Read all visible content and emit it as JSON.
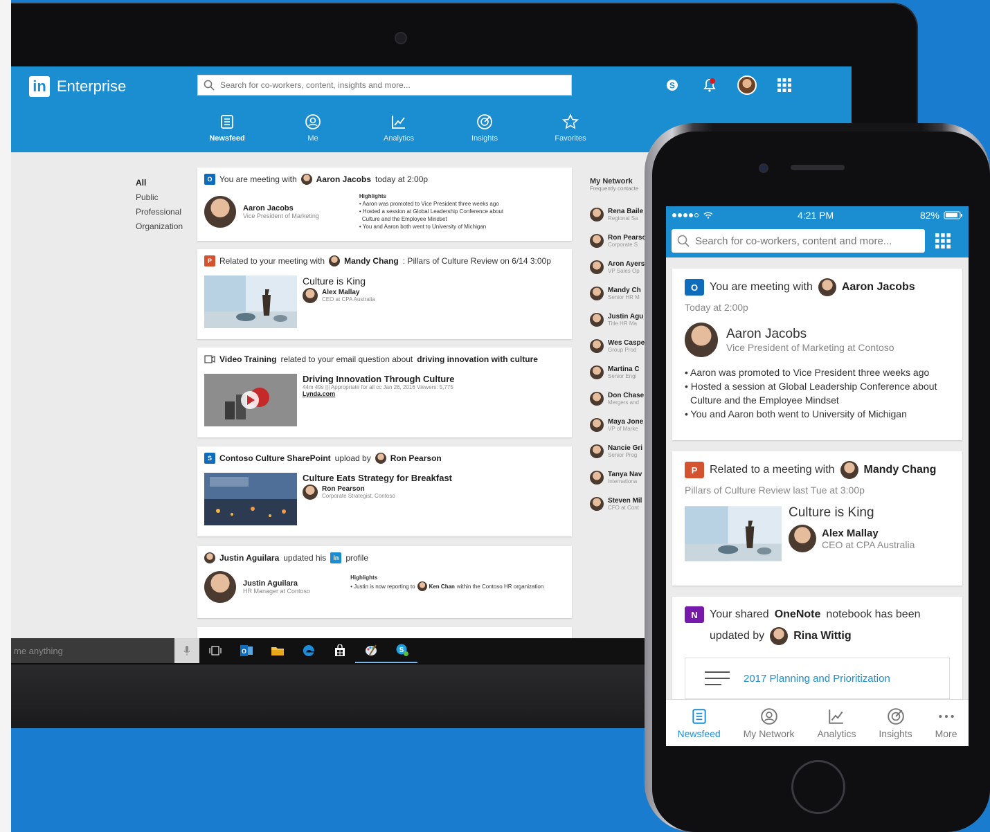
{
  "desktop": {
    "brand": "Enterprise",
    "search_placeholder": "Search for co-workers, content, insights and more...",
    "notification_count": "1",
    "tabs": [
      {
        "label": "Newsfeed",
        "icon": "newsfeed-icon",
        "active": true
      },
      {
        "label": "Me",
        "icon": "me-icon",
        "active": false
      },
      {
        "label": "Analytics",
        "icon": "analytics-icon",
        "active": false
      },
      {
        "label": "Insights",
        "icon": "insights-icon",
        "active": false
      },
      {
        "label": "Favorites",
        "icon": "star-icon",
        "active": false
      }
    ],
    "filters": [
      "All",
      "Public",
      "Professional",
      "Organization"
    ],
    "cards": {
      "meeting": {
        "prefix": "You are meeting with",
        "person": "Aaron Jacobs",
        "suffix": "today at 2:00p",
        "name": "Aaron Jacobs",
        "role": "Vice President of Marketing",
        "highlights_title": "Highlights",
        "highlights": [
          "• Aaron was promoted to Vice President three weeks ago",
          "• Hosted a session at Global Leadership Conference about",
          "  Culture and the Employee Mindset",
          "• You and Aaron both went to University of Michigan"
        ]
      },
      "related": {
        "prefix": "Related to your meeting with",
        "person": "Mandy Chang",
        "suffix": ": Pillars of Culture Review on 6/14 3:00p",
        "doc_title": "Culture is King",
        "author": "Alex Mallay",
        "author_role": "CEO at CPA Australia"
      },
      "video": {
        "prefix": "Video Training",
        "middle": "related to your email question about",
        "topic": "driving innovation with culture",
        "title": "Driving Innovation Through Culture",
        "meta": "44m 49s    |||  Appropriate for all    cc    Jan 26, 2016     Viewers: 5,775",
        "source": "Lynda.com"
      },
      "sharepoint": {
        "site": "Contoso Culture SharePoint",
        "middle": "upload by",
        "person": "Ron Pearson",
        "title": "Culture Eats Strategy for Breakfast",
        "author": "Ron Pearson",
        "author_role": "Corporate Strategist, Contoso"
      },
      "profile": {
        "person": "Justin Aguilara",
        "middle": "updated his",
        "suffix": "profile",
        "name": "Justin Aguilara",
        "role": "HR Manager at Contoso",
        "highlights_title": "Highlights",
        "highlight_prefix": "• Justin is now reporting to",
        "highlight_person": "Ken Chan",
        "highlight_suffix": "within the Contoso HR organization"
      }
    },
    "network": {
      "title": "My Network",
      "subtitle": "Frequently contacte",
      "people": [
        {
          "name": "Rena Baile",
          "role": "Regional Sa"
        },
        {
          "name": "Ron Pearso",
          "role": "Corporate S"
        },
        {
          "name": "Aron Ayers",
          "role": "VP Sales Op"
        },
        {
          "name": "Mandy Ch",
          "role": "Senior HR M"
        },
        {
          "name": "Justin Agu",
          "role": "Title HR Ma"
        },
        {
          "name": "Wes Caspe",
          "role": "Group Prod"
        },
        {
          "name": "Martina C",
          "role": "Senior Engi"
        },
        {
          "name": "Don Chase",
          "role": "Mergers and"
        },
        {
          "name": "Maya Jone",
          "role": "VP of Marke"
        },
        {
          "name": "Nancie Gri",
          "role": "Senior Prog"
        },
        {
          "name": "Tanya Nav",
          "role": "Internationa"
        },
        {
          "name": "Steven Mil",
          "role": "CFO at Cont"
        }
      ]
    },
    "taskbar": {
      "cortana_placeholder": "me anything"
    }
  },
  "phone": {
    "time": "4:21 PM",
    "battery": "82%",
    "search_placeholder": "Search for co-workers, content and more...",
    "meeting": {
      "prefix": "You are meeting with",
      "person": "Aaron Jacobs",
      "time": "Today at 2:00p",
      "name": "Aaron Jacobs",
      "role": "Vice President of Marketing at Contoso",
      "bullets": [
        "• Aaron was promoted to Vice President three weeks ago",
        "• Hosted a session at Global Leadership Conference about",
        "  Culture and the Employee Mindset",
        "• You and Aaron both went to University of Michigan"
      ]
    },
    "related": {
      "prefix": "Related to a meeting with",
      "person": "Mandy Chang",
      "sub": "Pillars of Culture Review last Tue at 3:00p",
      "doc_title": "Culture is King",
      "author": "Alex Mallay",
      "author_role": "CEO at CPA Australia"
    },
    "onenote": {
      "prefix": "Your shared",
      "app": "OneNote",
      "suffix": "notebook has been",
      "line2": "updated by",
      "person": "Rina Wittig",
      "notebook": "2017 Planning and Prioritization"
    },
    "nav": [
      {
        "label": "Newsfeed",
        "active": true
      },
      {
        "label": "My Network",
        "active": false
      },
      {
        "label": "Analytics",
        "active": false
      },
      {
        "label": "Insights",
        "active": false
      },
      {
        "label": "More",
        "active": false
      }
    ]
  },
  "colors": {
    "brand_blue": "#1b8ed1",
    "background_blue": "#1a7ccf",
    "outlook_blue": "#0f6cbd",
    "powerpoint_orange": "#d35230",
    "onenote_purple": "#7719aa",
    "notification_red": "#d81b1b"
  }
}
